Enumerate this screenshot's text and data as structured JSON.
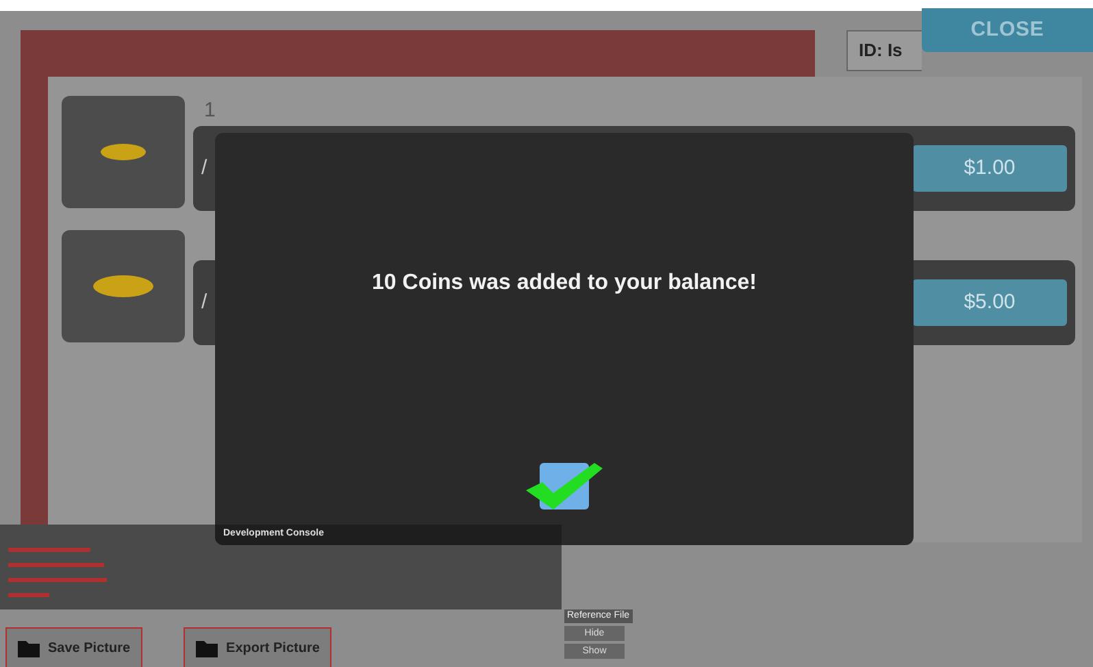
{
  "close_button": {
    "label": "CLOSE"
  },
  "id_field": {
    "value": "ID: Is"
  },
  "store_items": [
    {
      "number": "1",
      "name": "/",
      "price": "$1.00"
    },
    {
      "name": "/",
      "price": "$5.00"
    }
  ],
  "dialog": {
    "message": "10 Coins was added to your balance!"
  },
  "console": {
    "title": "Development Console"
  },
  "bottom_buttons": [
    {
      "label": "Save Picture"
    },
    {
      "label": "Export Picture"
    }
  ],
  "side_controls": [
    {
      "kind": "label",
      "text": "Reference File"
    },
    {
      "kind": "button",
      "text": "Hide"
    },
    {
      "kind": "button",
      "text": "Show"
    }
  ]
}
